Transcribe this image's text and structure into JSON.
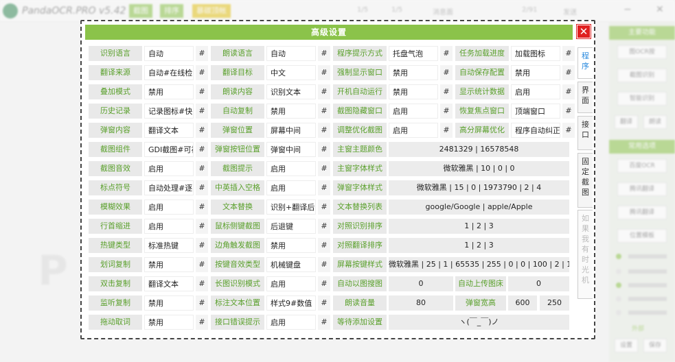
{
  "app": {
    "title": "PandaOCR.PRO v5.42",
    "top_buttons": [
      "截图",
      "排序",
      "暴碳顶帐"
    ],
    "top_labels": [
      "1/5",
      "1/5",
      "消息面",
      "  2/91",
      "发送"
    ],
    "min_label": "−",
    "close_label": "✕"
  },
  "right_panel": {
    "heads": [
      "主要功能",
      "常用选项"
    ],
    "buttons": [
      "图OCR按",
      "截图识别",
      "智能识别",
      "百度OCR",
      "腾讯翻译",
      "腾讯翻译",
      "位置模板"
    ],
    "half_buttons": [
      "翻译",
      "朗读",
      "设置",
      "保存"
    ],
    "status": "外部"
  },
  "watermark": "P",
  "dialog": {
    "title": "高级设置",
    "close_label": "✕",
    "tabs": [
      "程\n序",
      "界\n面",
      "接\n口",
      "固\n定\n截\n图",
      "如\n果\n我\n有\n时\n光\n机"
    ],
    "hash": "#",
    "rows": [
      {
        "c": [
          [
            "识别语言",
            "自动"
          ],
          [
            "朗读语言",
            "自动"
          ],
          [
            "程序提示方式",
            "托盘气泡"
          ],
          [
            "任务加载进度",
            "加载图标"
          ]
        ]
      },
      {
        "c": [
          [
            "翻译来源",
            "自动#在线检"
          ],
          [
            "翻译目标",
            "中文"
          ],
          [
            "强制显示窗口",
            "禁用"
          ],
          [
            "自动保存配置",
            "禁用"
          ]
        ]
      },
      {
        "c": [
          [
            "叠加模式",
            "禁用"
          ],
          [
            "朗读内容",
            "识别文本"
          ],
          [
            "开机自动运行",
            "禁用"
          ],
          [
            "显示统计数据",
            "启用"
          ]
        ]
      },
      {
        "c": [
          [
            "历史记录",
            "记录图标#快"
          ],
          [
            "自动复制",
            "禁用"
          ],
          [
            "截图隐藏窗口",
            "启用"
          ],
          [
            "恢复焦点窗口",
            "顶端窗口"
          ]
        ]
      },
      {
        "c": [
          [
            "弹窗内容",
            "翻译文本"
          ],
          [
            "弹窗位置",
            "屏幕中间"
          ],
          [
            "调整优化截图",
            "启用"
          ],
          [
            "高分屏幕优化",
            "程序自动纠正"
          ]
        ]
      },
      {
        "c": [
          [
            "截图组件",
            "GDI截图#可视"
          ],
          [
            "弹窗按钮位置",
            "弹窗中间"
          ]
        ],
        "label3": "主窗主题颜色",
        "wide": "2481329 | 16578548"
      },
      {
        "c": [
          [
            "截图音效",
            "启用"
          ],
          [
            "截图提示",
            "启用"
          ]
        ],
        "label3": "主窗字体样式",
        "wide": "微软雅黑 | 10 | 0 | 0"
      },
      {
        "c": [
          [
            "标点符号",
            "自动处理#逐"
          ],
          [
            "中英插入空格",
            "启用"
          ]
        ],
        "label3": "弹窗字体样式",
        "wide": "微软雅黑 | 15 | 0 | 1973790 | 2 | 4"
      },
      {
        "c": [
          [
            "模糊效果",
            "启用"
          ],
          [
            "文本替换",
            "识别+翻译后"
          ]
        ],
        "label3": "文本替换列表",
        "wide": "google/Google | apple/Apple"
      },
      {
        "c": [
          [
            "行首缩进",
            "启用"
          ],
          [
            "鼠标侧键截图",
            "后退键"
          ]
        ],
        "label3": "对照识别排序",
        "wide": "1 | 2 | 3"
      },
      {
        "c": [
          [
            "热键类型",
            "标准热键"
          ],
          [
            "边角触发截图",
            "禁用"
          ]
        ],
        "label3": "对照翻译排序",
        "wide": "1 | 2 | 3"
      },
      {
        "c": [
          [
            "划词复制",
            "禁用"
          ],
          [
            "按键音效类型",
            "机械键盘"
          ]
        ],
        "label3": "屏幕按键样式",
        "wide": "微软雅黑 | 25 | 1 | 65535 | 255 | 0 | 0 | 100 | 2 | 1"
      }
    ],
    "row13": {
      "a": [
        "双击复制",
        "翻译文本"
      ],
      "b": [
        "长图识别模式",
        "启用"
      ],
      "c_label": "自动以图搜图",
      "c_val": "0",
      "d_label": "自动上传图床",
      "d_val": "0"
    },
    "row14": {
      "a": [
        "监听复制",
        "禁用"
      ],
      "b": [
        "标注文本位置",
        "样式9#数值"
      ],
      "c_label": "朗读音量",
      "c_val": "80",
      "d_label": "弹窗宽高",
      "d_val1": "600",
      "d_val2": "250"
    },
    "row15": {
      "a": [
        "拖动取词",
        "禁用"
      ],
      "b": [
        "接口错误提示",
        "启用"
      ],
      "c_label": "等待添加设置",
      "c_val": "ヽ(￣_￣)ノ"
    }
  }
}
